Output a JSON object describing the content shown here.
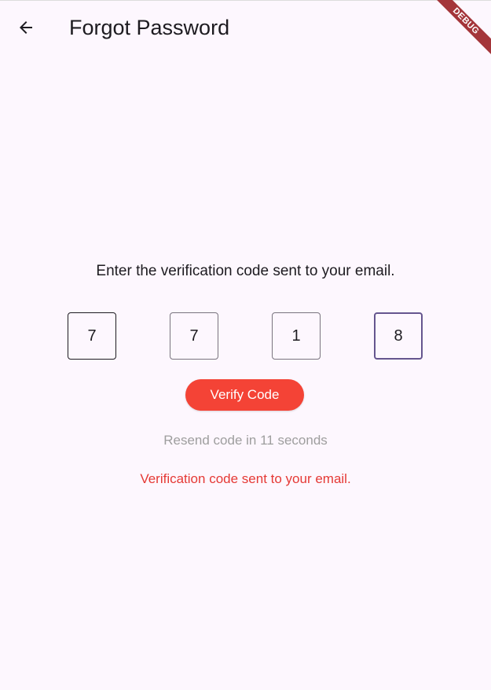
{
  "app_bar": {
    "title": "Forgot Password",
    "back_icon": "arrow-left-icon"
  },
  "debug_banner": {
    "label": "DEBUG",
    "color": "#a4353a"
  },
  "instruction": "Enter the verification code sent to your email.",
  "code_digits": [
    "7",
    "7",
    "1",
    "8"
  ],
  "verify_button": {
    "label": "Verify Code",
    "color": "#f44336"
  },
  "resend_text": "Resend code in 11 seconds",
  "status_message": "Verification code sent to your email.",
  "colors": {
    "background": "#fdf7fe",
    "focus_border": "#65558f",
    "status_text": "#e53935",
    "muted_text": "#9e9e9e"
  }
}
